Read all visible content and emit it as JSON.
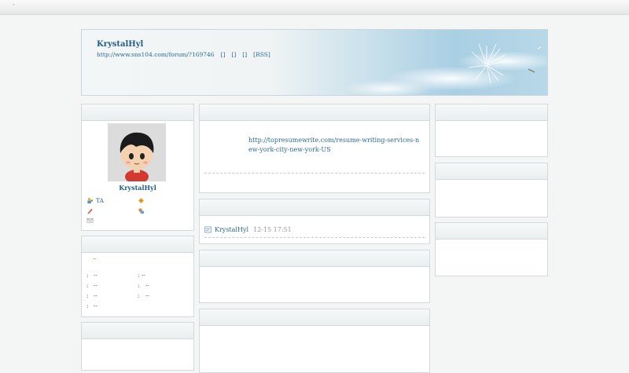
{
  "topbar": {
    "marker": "-"
  },
  "banner": {
    "title": "KrystalHyl",
    "url": "http://www.sns104.com/forum/?169746",
    "link_a": "[]",
    "link_b": "[]",
    "link_c": "[]",
    "rss": "[RSS]"
  },
  "profile": {
    "username": "KrystalHyl",
    "actions": [
      "TA",
      "",
      "",
      "",
      ""
    ]
  },
  "stats": {
    "headline": "--",
    "rows": [
      [
        ":",
        "--",
        ":",
        "--"
      ],
      [
        ":",
        "--",
        ":",
        "--"
      ],
      [
        ":",
        "--",
        ":",
        "--"
      ],
      [
        ":",
        "--"
      ]
    ]
  },
  "post": {
    "link": "http://topresumewrite.com/resume-writing-services-new-york-city-new-york-US"
  },
  "messages": [
    {
      "author": "KrystalHyl",
      "time": "12-15 17:51"
    }
  ]
}
